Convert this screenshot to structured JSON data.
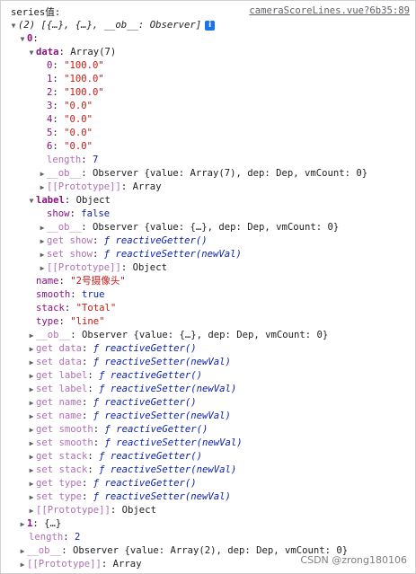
{
  "header": {
    "title": "series值:",
    "source": "cameraScoreLines.vue?6b35:89"
  },
  "tree": [
    {
      "indent": 10,
      "tri": "▼",
      "parts": [
        [
          "plain italic",
          "(2) [{…}, {…}, __ob__: Observer]"
        ]
      ],
      "info": true
    },
    {
      "indent": 20,
      "tri": "▼",
      "parts": [
        [
          "key bold",
          "0"
        ],
        [
          "plain",
          ":"
        ]
      ]
    },
    {
      "indent": 30,
      "tri": "▼",
      "parts": [
        [
          "key bold",
          "data"
        ],
        [
          "plain",
          ": Array(7)"
        ]
      ]
    },
    {
      "indent": 52,
      "tri": "",
      "parts": [
        [
          "key",
          "0"
        ],
        [
          "plain",
          ": "
        ],
        [
          "str",
          "\"100.0\""
        ]
      ]
    },
    {
      "indent": 52,
      "tri": "",
      "parts": [
        [
          "key",
          "1"
        ],
        [
          "plain",
          ": "
        ],
        [
          "str",
          "\"100.0\""
        ]
      ]
    },
    {
      "indent": 52,
      "tri": "",
      "parts": [
        [
          "key",
          "2"
        ],
        [
          "plain",
          ": "
        ],
        [
          "str",
          "\"100.0\""
        ]
      ]
    },
    {
      "indent": 52,
      "tri": "",
      "parts": [
        [
          "key",
          "3"
        ],
        [
          "plain",
          ": "
        ],
        [
          "str",
          "\"0.0\""
        ]
      ]
    },
    {
      "indent": 52,
      "tri": "",
      "parts": [
        [
          "key",
          "4"
        ],
        [
          "plain",
          ": "
        ],
        [
          "str",
          "\"0.0\""
        ]
      ]
    },
    {
      "indent": 52,
      "tri": "",
      "parts": [
        [
          "key",
          "5"
        ],
        [
          "plain",
          ": "
        ],
        [
          "str",
          "\"0.0\""
        ]
      ]
    },
    {
      "indent": 52,
      "tri": "",
      "parts": [
        [
          "key",
          "6"
        ],
        [
          "plain",
          ": "
        ],
        [
          "str",
          "\"0.0\""
        ]
      ]
    },
    {
      "indent": 52,
      "tri": "",
      "parts": [
        [
          "key dim",
          "length"
        ],
        [
          "plain",
          ": "
        ],
        [
          "num",
          "7"
        ]
      ]
    },
    {
      "indent": 42,
      "tri": "▶",
      "parts": [
        [
          "key dim",
          "__ob__"
        ],
        [
          "plain",
          ": Observer {value: Array(7), dep: Dep, vmCount: 0}"
        ]
      ]
    },
    {
      "indent": 42,
      "tri": "▶",
      "parts": [
        [
          "key dim",
          "[[Prototype]]"
        ],
        [
          "plain",
          ": Array"
        ]
      ]
    },
    {
      "indent": 30,
      "tri": "▼",
      "parts": [
        [
          "key bold",
          "label"
        ],
        [
          "plain",
          ": Object"
        ]
      ]
    },
    {
      "indent": 52,
      "tri": "",
      "parts": [
        [
          "key",
          "show"
        ],
        [
          "plain",
          ": "
        ],
        [
          "kw",
          "false"
        ]
      ]
    },
    {
      "indent": 42,
      "tri": "▶",
      "parts": [
        [
          "key dim",
          "__ob__"
        ],
        [
          "plain",
          ": Observer {value: {…}, dep: Dep, vmCount: 0}"
        ]
      ]
    },
    {
      "indent": 42,
      "tri": "▶",
      "parts": [
        [
          "key dim",
          "get show"
        ],
        [
          "plain",
          ": "
        ],
        [
          "fn",
          "ƒ reactiveGetter()"
        ]
      ]
    },
    {
      "indent": 42,
      "tri": "▶",
      "parts": [
        [
          "key dim",
          "set show"
        ],
        [
          "plain",
          ": "
        ],
        [
          "fn",
          "ƒ reactiveSetter(newVal)"
        ]
      ]
    },
    {
      "indent": 42,
      "tri": "▶",
      "parts": [
        [
          "key dim",
          "[[Prototype]]"
        ],
        [
          "plain",
          ": Object"
        ]
      ]
    },
    {
      "indent": 40,
      "tri": "",
      "parts": [
        [
          "key",
          "name"
        ],
        [
          "plain",
          ": "
        ],
        [
          "str",
          "\"2号摄像头\""
        ]
      ]
    },
    {
      "indent": 40,
      "tri": "",
      "parts": [
        [
          "key",
          "smooth"
        ],
        [
          "plain",
          ": "
        ],
        [
          "kw",
          "true"
        ]
      ]
    },
    {
      "indent": 40,
      "tri": "",
      "parts": [
        [
          "key",
          "stack"
        ],
        [
          "plain",
          ": "
        ],
        [
          "str",
          "\"Total\""
        ]
      ]
    },
    {
      "indent": 40,
      "tri": "",
      "parts": [
        [
          "key",
          "type"
        ],
        [
          "plain",
          ": "
        ],
        [
          "str",
          "\"line\""
        ]
      ]
    },
    {
      "indent": 30,
      "tri": "▶",
      "parts": [
        [
          "key dim",
          "__ob__"
        ],
        [
          "plain",
          ": Observer {value: {…}, dep: Dep, vmCount: 0}"
        ]
      ]
    },
    {
      "indent": 30,
      "tri": "▶",
      "parts": [
        [
          "key dim",
          "get data"
        ],
        [
          "plain",
          ": "
        ],
        [
          "fn",
          "ƒ reactiveGetter()"
        ]
      ]
    },
    {
      "indent": 30,
      "tri": "▶",
      "parts": [
        [
          "key dim",
          "set data"
        ],
        [
          "plain",
          ": "
        ],
        [
          "fn",
          "ƒ reactiveSetter(newVal)"
        ]
      ]
    },
    {
      "indent": 30,
      "tri": "▶",
      "parts": [
        [
          "key dim",
          "get label"
        ],
        [
          "plain",
          ": "
        ],
        [
          "fn",
          "ƒ reactiveGetter()"
        ]
      ]
    },
    {
      "indent": 30,
      "tri": "▶",
      "parts": [
        [
          "key dim",
          "set label"
        ],
        [
          "plain",
          ": "
        ],
        [
          "fn",
          "ƒ reactiveSetter(newVal)"
        ]
      ]
    },
    {
      "indent": 30,
      "tri": "▶",
      "parts": [
        [
          "key dim",
          "get name"
        ],
        [
          "plain",
          ": "
        ],
        [
          "fn",
          "ƒ reactiveGetter()"
        ]
      ]
    },
    {
      "indent": 30,
      "tri": "▶",
      "parts": [
        [
          "key dim",
          "set name"
        ],
        [
          "plain",
          ": "
        ],
        [
          "fn",
          "ƒ reactiveSetter(newVal)"
        ]
      ]
    },
    {
      "indent": 30,
      "tri": "▶",
      "parts": [
        [
          "key dim",
          "get smooth"
        ],
        [
          "plain",
          ": "
        ],
        [
          "fn",
          "ƒ reactiveGetter()"
        ]
      ]
    },
    {
      "indent": 30,
      "tri": "▶",
      "parts": [
        [
          "key dim",
          "set smooth"
        ],
        [
          "plain",
          ": "
        ],
        [
          "fn",
          "ƒ reactiveSetter(newVal)"
        ]
      ]
    },
    {
      "indent": 30,
      "tri": "▶",
      "parts": [
        [
          "key dim",
          "get stack"
        ],
        [
          "plain",
          ": "
        ],
        [
          "fn",
          "ƒ reactiveGetter()"
        ]
      ]
    },
    {
      "indent": 30,
      "tri": "▶",
      "parts": [
        [
          "key dim",
          "set stack"
        ],
        [
          "plain",
          ": "
        ],
        [
          "fn",
          "ƒ reactiveSetter(newVal)"
        ]
      ]
    },
    {
      "indent": 30,
      "tri": "▶",
      "parts": [
        [
          "key dim",
          "get type"
        ],
        [
          "plain",
          ": "
        ],
        [
          "fn",
          "ƒ reactiveGetter()"
        ]
      ]
    },
    {
      "indent": 30,
      "tri": "▶",
      "parts": [
        [
          "key dim",
          "set type"
        ],
        [
          "plain",
          ": "
        ],
        [
          "fn",
          "ƒ reactiveSetter(newVal)"
        ]
      ]
    },
    {
      "indent": 30,
      "tri": "▶",
      "parts": [
        [
          "key dim",
          "[[Prototype]]"
        ],
        [
          "plain",
          ": Object"
        ]
      ]
    },
    {
      "indent": 20,
      "tri": "▶",
      "parts": [
        [
          "key bold",
          "1"
        ],
        [
          "plain",
          ": {…}"
        ]
      ]
    },
    {
      "indent": 32,
      "tri": "",
      "parts": [
        [
          "key dim",
          "length"
        ],
        [
          "plain",
          ": "
        ],
        [
          "num",
          "2"
        ]
      ]
    },
    {
      "indent": 20,
      "tri": "▶",
      "parts": [
        [
          "key dim",
          "__ob__"
        ],
        [
          "plain",
          ": Observer {value: Array(2), dep: Dep, vmCount: 0}"
        ]
      ]
    },
    {
      "indent": 20,
      "tri": "▶",
      "parts": [
        [
          "key dim",
          "[[Prototype]]"
        ],
        [
          "plain",
          ": Array"
        ]
      ]
    }
  ],
  "watermark": "CSDN @zrong180106"
}
